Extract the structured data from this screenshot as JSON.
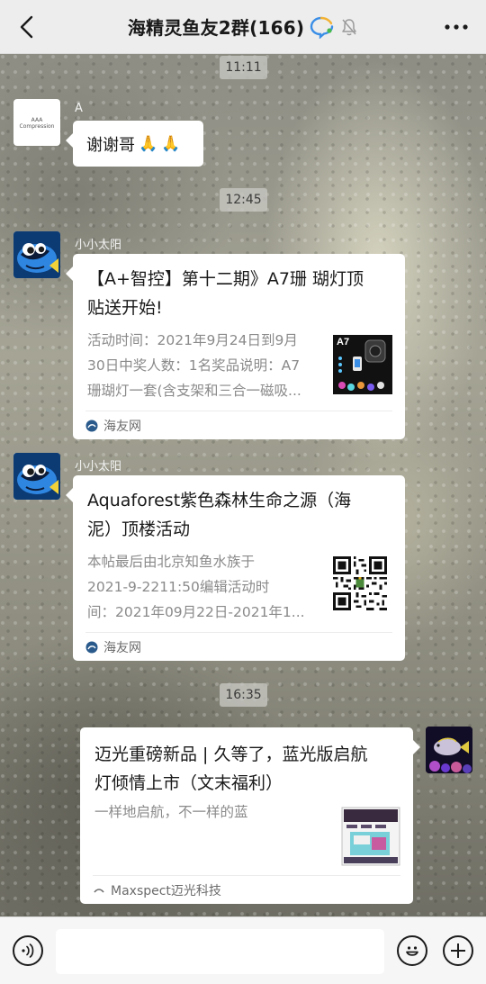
{
  "header": {
    "title": "海精灵鱼友2群(166)"
  },
  "messages": [
    {
      "time": "11:11"
    },
    {
      "sender": "A",
      "avatar_text": "AAA Compression",
      "text": "谢谢哥",
      "emoji": [
        "🙏",
        "🙏"
      ]
    },
    {
      "time": "12:45"
    },
    {
      "sender": "小小太阳",
      "title": "【A+智控】第十二期》A7珊 瑚灯顶贴送开始!",
      "title_lines": [
        "【A+智控】第十二期》A7珊 瑚灯顶",
        "贴送开始!"
      ],
      "desc_lines": [
        "活动时间：2021年9月24日到9月",
        "30日中奖人数：1名奖品说明：A7",
        "珊瑚灯一套(含支架和三合一磁吸..."
      ],
      "thumb_label": "A7",
      "source": "海友网"
    },
    {
      "sender": "小小太阳",
      "title_lines": [
        "Aquaforest紫色森林生命之源（海",
        "泥）顶楼活动"
      ],
      "desc_lines": [
        "本帖最后由北京知鱼水族于",
        "2021-9-2211:50编辑活动时",
        "间：2021年09月22日-2021年1..."
      ],
      "source": "海友网"
    },
    {
      "time": "16:35"
    },
    {
      "title_lines": [
        "迈光重磅新品 | 久等了，蓝光版启航",
        "灯倾情上市（文末福利）"
      ],
      "desc_lines": [
        "一样地启航，不一样的蓝"
      ],
      "source": "Maxspect迈光科技"
    }
  ],
  "footer": {
    "input_value": ""
  },
  "colors": {
    "header_bg": "#ededed",
    "bubble_bg": "#ffffff",
    "timestamp_bg": "#c8c8c3",
    "hai_you_logo": "#2a5a8c"
  }
}
